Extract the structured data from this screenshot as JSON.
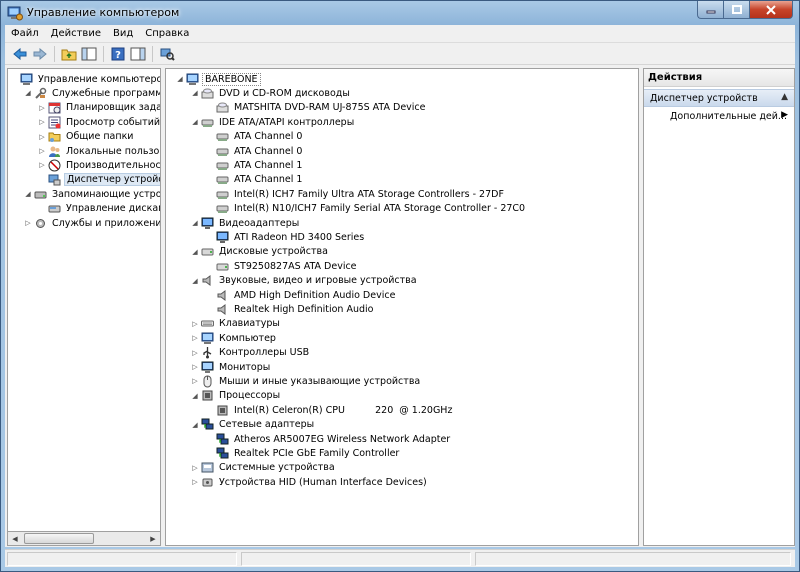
{
  "window": {
    "title": "Управление компьютером"
  },
  "menubar": {
    "items": [
      "Файл",
      "Действие",
      "Вид",
      "Справка"
    ]
  },
  "left_tree": [
    {
      "label": "Управление компьютером (л",
      "level": 0,
      "expander": "",
      "icon": "computer-management-icon"
    },
    {
      "label": "Служебные программы",
      "level": 1,
      "expander": "open",
      "icon": "tools-icon"
    },
    {
      "label": "Планировщик заданий",
      "level": 2,
      "expander": "closed",
      "icon": "task-scheduler-icon"
    },
    {
      "label": "Просмотр событий",
      "level": 2,
      "expander": "closed",
      "icon": "event-viewer-icon"
    },
    {
      "label": "Общие папки",
      "level": 2,
      "expander": "closed",
      "icon": "shared-folder-icon"
    },
    {
      "label": "Локальные пользовате",
      "level": 2,
      "expander": "closed",
      "icon": "users-icon"
    },
    {
      "label": "Производительность",
      "level": 2,
      "expander": "closed",
      "icon": "performance-icon"
    },
    {
      "label": "Диспетчер устройств",
      "level": 2,
      "expander": "",
      "icon": "device-manager-icon",
      "selected": true
    },
    {
      "label": "Запоминающие устройст",
      "level": 1,
      "expander": "open",
      "icon": "storage-icon"
    },
    {
      "label": "Управление дисками",
      "level": 2,
      "expander": "",
      "icon": "disk-management-icon"
    },
    {
      "label": "Службы и приложения",
      "level": 1,
      "expander": "closed",
      "icon": "services-icon"
    }
  ],
  "device_tree": [
    {
      "label": "BAREBONE",
      "level": 0,
      "expander": "open",
      "icon": "computer-icon"
    },
    {
      "label": "DVD и CD-ROM дисководы",
      "level": 1,
      "expander": "open",
      "icon": "dvd-drive-icon"
    },
    {
      "label": "MATSHITA DVD-RAM UJ-875S ATA Device",
      "level": 2,
      "expander": "",
      "icon": "dvd-drive-icon"
    },
    {
      "label": "IDE ATA/ATAPI контроллеры",
      "level": 1,
      "expander": "open",
      "icon": "ide-controller-icon"
    },
    {
      "label": "ATA Channel 0",
      "level": 2,
      "expander": "",
      "icon": "ide-controller-icon"
    },
    {
      "label": "ATA Channel 0",
      "level": 2,
      "expander": "",
      "icon": "ide-controller-icon"
    },
    {
      "label": "ATA Channel 1",
      "level": 2,
      "expander": "",
      "icon": "ide-controller-icon"
    },
    {
      "label": "ATA Channel 1",
      "level": 2,
      "expander": "",
      "icon": "ide-controller-icon"
    },
    {
      "label": "Intel(R) ICH7 Family Ultra ATA Storage Controllers - 27DF",
      "level": 2,
      "expander": "",
      "icon": "ide-controller-icon"
    },
    {
      "label": "Intel(R) N10/ICH7 Family Serial ATA Storage Controller - 27C0",
      "level": 2,
      "expander": "",
      "icon": "ide-controller-icon"
    },
    {
      "label": "Видеоадаптеры",
      "level": 1,
      "expander": "open",
      "icon": "display-adapter-icon"
    },
    {
      "label": "ATI Radeon HD 3400 Series",
      "level": 2,
      "expander": "",
      "icon": "display-adapter-icon"
    },
    {
      "label": "Дисковые устройства",
      "level": 1,
      "expander": "open",
      "icon": "disk-drive-icon"
    },
    {
      "label": "ST9250827AS ATA Device",
      "level": 2,
      "expander": "",
      "icon": "disk-drive-icon"
    },
    {
      "label": "Звуковые, видео и игровые устройства",
      "level": 1,
      "expander": "open",
      "icon": "speaker-icon"
    },
    {
      "label": "AMD High Definition Audio Device",
      "level": 2,
      "expander": "",
      "icon": "speaker-icon"
    },
    {
      "label": "Realtek High Definition Audio",
      "level": 2,
      "expander": "",
      "icon": "speaker-icon"
    },
    {
      "label": "Клавиатуры",
      "level": 1,
      "expander": "closed",
      "icon": "keyboard-icon"
    },
    {
      "label": "Компьютер",
      "level": 1,
      "expander": "closed",
      "icon": "computer-icon"
    },
    {
      "label": "Контроллеры USB",
      "level": 1,
      "expander": "closed",
      "icon": "usb-icon"
    },
    {
      "label": "Мониторы",
      "level": 1,
      "expander": "closed",
      "icon": "monitor-icon"
    },
    {
      "label": "Мыши и иные указывающие устройства",
      "level": 1,
      "expander": "closed",
      "icon": "mouse-icon"
    },
    {
      "label": "Процессоры",
      "level": 1,
      "expander": "open",
      "icon": "processor-icon"
    },
    {
      "label": "Intel(R) Celeron(R) CPU          220  @ 1.20GHz",
      "level": 2,
      "expander": "",
      "icon": "processor-icon"
    },
    {
      "label": "Сетевые адаптеры",
      "level": 1,
      "expander": "open",
      "icon": "network-adapter-icon"
    },
    {
      "label": "Atheros AR5007EG Wireless Network Adapter",
      "level": 2,
      "expander": "",
      "icon": "network-adapter-icon"
    },
    {
      "label": "Realtek PCIe GbE Family Controller",
      "level": 2,
      "expander": "",
      "icon": "network-adapter-icon"
    },
    {
      "label": "Системные устройства",
      "level": 1,
      "expander": "closed",
      "icon": "system-device-icon"
    },
    {
      "label": "Устройства HID (Human Interface Devices)",
      "level": 1,
      "expander": "closed",
      "icon": "hid-icon"
    }
  ],
  "actions": {
    "header": "Действия",
    "section": "Диспетчер устройств",
    "item": "Дополнительные дей..."
  }
}
